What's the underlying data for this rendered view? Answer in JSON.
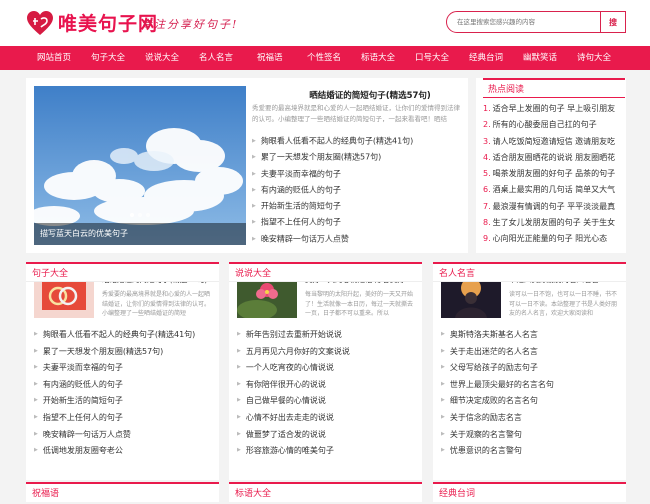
{
  "header": {
    "logo_text": "唯美句子网",
    "slogan": "专注分享好句子!",
    "search_placeholder": "在这里搜索您感兴趣的内容",
    "search_button": "搜"
  },
  "nav": [
    "网站首页",
    "句子大全",
    "说说大全",
    "名人名言",
    "祝福语",
    "个性签名",
    "标语大全",
    "口号大全",
    "经典台词",
    "幽默笑话",
    "诗句大全"
  ],
  "hero": {
    "caption": "描写蓝天白云的优美句子"
  },
  "featured": {
    "title": "晒结婚证的简短句子(精选57句)",
    "desc": "秀爱要的最高境界就是和心爱的人一起晒结婚证，让你们的爱情得到法律的认可。小编整理了一些晒结婚证的简短句子，一起来看看吧！晒结",
    "items": [
      "夠眼看人低看不起人的经典句子(精选41句)",
      "累了一天想发个朋友圈(精选57句)",
      "夫妻平淡而幸福的句子",
      "有内涵的贬低人的句子",
      "开始新生活的简短句子",
      "指望不上任何人的句子",
      "晚安精辟一句话万人点赞"
    ]
  },
  "hot": {
    "title": "热点阅读",
    "items": [
      {
        "num": "1.",
        "text": "适合早上发圈的句子 早上吸引朋友"
      },
      {
        "num": "2.",
        "text": "所有的心酸委屈自己扛的句子"
      },
      {
        "num": "3.",
        "text": "请人吃饭简短邀请短信 邀请朋友吃"
      },
      {
        "num": "4.",
        "text": "适合朋友圈晒花的说说 朋友圈晒花"
      },
      {
        "num": "5.",
        "text": "喝茶发朋友圈的好句子 品茶的句子"
      },
      {
        "num": "6.",
        "text": "酒桌上最实用的几句话 简单又大气"
      },
      {
        "num": "7.",
        "text": "最浪漫有情调的句子 平平淡淡最真"
      },
      {
        "num": "8.",
        "text": "生了女儿发朋友圈的句子 关于生女"
      },
      {
        "num": "9.",
        "text": "心向阳光正能量的句子 阳光心态"
      }
    ]
  },
  "sections": [
    {
      "title": "句子大全",
      "head": "晒结婚证的简短句子(精选57句)",
      "desc": "秀爱要的最高境界就是和心爱的人一起晒结婚证，让你们的爱情得到法律的认可。小编整理了一些晒结婚证的简短",
      "items": [
        "夠眼看人低看不起人的经典句子(精选41句)",
        "累了一天想发个朋友圈(精选57句)",
        "夫妻平淡而幸福的句子",
        "有内涵的贬低人的句子",
        "开始新生活的简短句子",
        "指望不上任何人的句子",
        "晚安精辟一句话万人点赞",
        "低调地发朋友圈夸老公"
      ]
    },
    {
      "title": "说说大全",
      "head": "美好一天的心情短语 形容美好",
      "desc": "每当黎明的太阳升起，美好的一天又开始了！生活就像一本日历，每过一天就撕去一页，日子都不可以重来。所以",
      "items": [
        "新年告别过去重新开始说说",
        "五月再见六月你好的文案说说",
        "一个人吃宵夜的心情说说",
        "有你陪伴很开心的说说",
        "自己做早餐的心情说说",
        "心情不好出去走走的说说",
        "做噩梦了适合发的说说",
        "形容旅游心情的唯美句子"
      ]
    },
    {
      "title": "名人名言",
      "head": "书是人类好朋友的名人名言",
      "desc": "读可以一日不饱，也可以一日不睡，书不可以一日不读。本站整理了书是人类好朋友的名人名言，欢迎大家阅读和",
      "items": [
        "奥斯特洛夫斯基名人名言",
        "关于走出迷茫的名人名言",
        "父母写给孩子的励志句子",
        "世界上最顶尖最好的名言名句",
        "细节决定成败的名言名句",
        "关于信念的励志名言",
        "关于观察的名言警句",
        "忧患意识的名言警句"
      ]
    }
  ],
  "bottom": [
    "祝福语",
    "标语大全",
    "经典台词"
  ]
}
